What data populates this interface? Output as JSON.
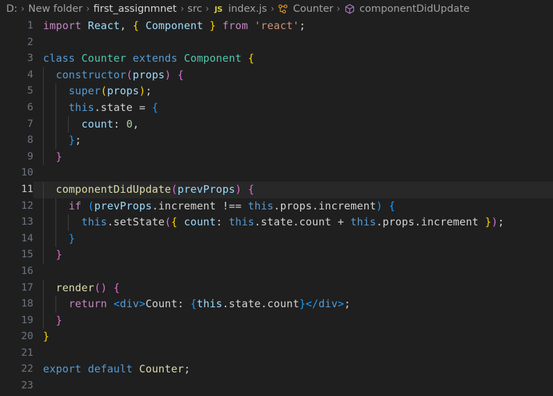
{
  "breadcrumb": {
    "items": [
      {
        "label": "D:",
        "icon": null,
        "bright": false
      },
      {
        "label": "New folder",
        "icon": null,
        "bright": false
      },
      {
        "label": "first_assignmnet",
        "icon": null,
        "bright": true
      },
      {
        "label": "src",
        "icon": null,
        "bright": false
      },
      {
        "label": "index.js",
        "icon": "js-file-icon",
        "bright": false
      },
      {
        "label": "Counter",
        "icon": "symbol-class-icon",
        "bright": false
      },
      {
        "label": "componentDidUpdate",
        "icon": "symbol-method-icon",
        "bright": false
      }
    ],
    "separator": "›"
  },
  "editor": {
    "language": "javascript",
    "current_line": 11,
    "total_lines": 23,
    "colors": {
      "background": "#1f1f1f",
      "current_line_background": "#282828",
      "line_number": "#6e7681",
      "line_number_active": "#cccccc",
      "foreground": "#d4d4d4",
      "keyword_control": "#c586c0",
      "keyword": "#569cd6",
      "variable": "#9cdcfe",
      "function": "#dcdcaa",
      "string": "#ce9178",
      "number": "#b5cea8",
      "bracket_yellow": "#ffd700",
      "bracket_pink": "#da70d6",
      "bracket_blue": "#179fff",
      "indent_guide": "#404040"
    },
    "lines": [
      {
        "n": 1,
        "text": "import React, { Component } from 'react';"
      },
      {
        "n": 2,
        "text": ""
      },
      {
        "n": 3,
        "text": "class Counter extends Component {"
      },
      {
        "n": 4,
        "text": "  constructor(props) {"
      },
      {
        "n": 5,
        "text": "    super(props);"
      },
      {
        "n": 6,
        "text": "    this.state = {"
      },
      {
        "n": 7,
        "text": "      count: 0,"
      },
      {
        "n": 8,
        "text": "    };"
      },
      {
        "n": 9,
        "text": "  }"
      },
      {
        "n": 10,
        "text": ""
      },
      {
        "n": 11,
        "text": "  componentDidUpdate(prevProps) {"
      },
      {
        "n": 12,
        "text": "    if (prevProps.increment !== this.props.increment) {"
      },
      {
        "n": 13,
        "text": "      this.setState({ count: this.state.count + this.props.increment });"
      },
      {
        "n": 14,
        "text": "    }"
      },
      {
        "n": 15,
        "text": "  }"
      },
      {
        "n": 16,
        "text": ""
      },
      {
        "n": 17,
        "text": "  render() {"
      },
      {
        "n": 18,
        "text": "    return <div>Count: {this.state.count}</div>;"
      },
      {
        "n": 19,
        "text": "  }"
      },
      {
        "n": 20,
        "text": "}"
      },
      {
        "n": 21,
        "text": ""
      },
      {
        "n": 22,
        "text": "export default Counter;"
      },
      {
        "n": 23,
        "text": ""
      }
    ],
    "tokens": [
      [
        [
          "import ",
          "kw"
        ],
        [
          "React",
          "ident"
        ],
        [
          ", ",
          "plain"
        ],
        [
          "{",
          "b-y"
        ],
        [
          " ",
          "plain"
        ],
        [
          "Component",
          "ident"
        ],
        [
          " ",
          "plain"
        ],
        [
          "}",
          "b-y"
        ],
        [
          " ",
          "plain"
        ],
        [
          "from",
          "kw"
        ],
        [
          " ",
          "plain"
        ],
        [
          "'react'",
          "str"
        ],
        [
          ";",
          "plain"
        ]
      ],
      [],
      [
        [
          "class",
          "kw2"
        ],
        [
          " ",
          "plain"
        ],
        [
          "Counter",
          "cls"
        ],
        [
          " ",
          "plain"
        ],
        [
          "extends",
          "kw2"
        ],
        [
          " ",
          "plain"
        ],
        [
          "Component",
          "cls"
        ],
        [
          " ",
          "plain"
        ],
        [
          "{",
          "b-y"
        ]
      ],
      [
        [
          "  ",
          "plain"
        ],
        [
          "constructor",
          "kw2"
        ],
        [
          "(",
          "b-p"
        ],
        [
          "props",
          "ident"
        ],
        [
          ")",
          "b-p"
        ],
        [
          " ",
          "plain"
        ],
        [
          "{",
          "b-p"
        ]
      ],
      [
        [
          "    ",
          "plain"
        ],
        [
          "super",
          "kw2"
        ],
        [
          "(",
          "b-y"
        ],
        [
          "props",
          "ident"
        ],
        [
          ")",
          "b-y"
        ],
        [
          ";",
          "plain"
        ]
      ],
      [
        [
          "    ",
          "plain"
        ],
        [
          "this",
          "kw2"
        ],
        [
          ".state",
          "plain"
        ],
        [
          " = ",
          "plain"
        ],
        [
          "{",
          "b-b"
        ]
      ],
      [
        [
          "      ",
          "plain"
        ],
        [
          "count",
          "ident"
        ],
        [
          ": ",
          "plain"
        ],
        [
          "0",
          "num"
        ],
        [
          ",",
          "plain"
        ]
      ],
      [
        [
          "    ",
          "plain"
        ],
        [
          "}",
          "b-b"
        ],
        [
          ";",
          "plain"
        ]
      ],
      [
        [
          "  ",
          "plain"
        ],
        [
          "}",
          "b-p"
        ]
      ],
      [],
      [
        [
          "  ",
          "plain"
        ],
        [
          "componentDidUpdate",
          "fn"
        ],
        [
          "(",
          "b-p"
        ],
        [
          "prevProps",
          "ident"
        ],
        [
          ")",
          "b-p"
        ],
        [
          " ",
          "plain"
        ],
        [
          "{",
          "b-p"
        ]
      ],
      [
        [
          "    ",
          "plain"
        ],
        [
          "if",
          "kw"
        ],
        [
          " ",
          "plain"
        ],
        [
          "(",
          "b-b"
        ],
        [
          "prevProps",
          "ident"
        ],
        [
          ".increment",
          "plain"
        ],
        [
          " !== ",
          "plain"
        ],
        [
          "this",
          "kw2"
        ],
        [
          ".props.increment",
          "plain"
        ],
        [
          ")",
          "b-b"
        ],
        [
          " ",
          "plain"
        ],
        [
          "{",
          "b-b"
        ]
      ],
      [
        [
          "      ",
          "plain"
        ],
        [
          "this",
          "kw2"
        ],
        [
          ".setState",
          "plain"
        ],
        [
          "(",
          "b-p"
        ],
        [
          "{",
          "b-y"
        ],
        [
          " ",
          "plain"
        ],
        [
          "count",
          "ident"
        ],
        [
          ": ",
          "plain"
        ],
        [
          "this",
          "kw2"
        ],
        [
          ".state.count",
          "plain"
        ],
        [
          " + ",
          "plain"
        ],
        [
          "this",
          "kw2"
        ],
        [
          ".props.increment",
          "plain"
        ],
        [
          " ",
          "plain"
        ],
        [
          "}",
          "b-y"
        ],
        [
          ")",
          "b-p"
        ],
        [
          ";",
          "plain"
        ]
      ],
      [
        [
          "    ",
          "plain"
        ],
        [
          "}",
          "b-b"
        ]
      ],
      [
        [
          "  ",
          "plain"
        ],
        [
          "}",
          "b-p"
        ]
      ],
      [],
      [
        [
          "  ",
          "plain"
        ],
        [
          "render",
          "fn"
        ],
        [
          "(",
          "b-p"
        ],
        [
          ")",
          "b-p"
        ],
        [
          " ",
          "plain"
        ],
        [
          "{",
          "b-p"
        ]
      ],
      [
        [
          "    ",
          "plain"
        ],
        [
          "return",
          "kw"
        ],
        [
          " ",
          "plain"
        ],
        [
          "<",
          "b-b"
        ],
        [
          "div",
          "tagname"
        ],
        [
          ">",
          "b-b"
        ],
        [
          "Count: ",
          "plain"
        ],
        [
          "{",
          "b-b"
        ],
        [
          "this",
          "ident"
        ],
        [
          ".state.count",
          "plain"
        ],
        [
          "}",
          "b-b"
        ],
        [
          "</",
          "b-b"
        ],
        [
          "div",
          "tagname"
        ],
        [
          ">",
          "b-b"
        ],
        [
          ";",
          "plain"
        ]
      ],
      [
        [
          "  ",
          "plain"
        ],
        [
          "}",
          "b-p"
        ]
      ],
      [
        [
          "}",
          "b-y"
        ]
      ],
      [],
      [
        [
          "export",
          "kw2"
        ],
        [
          " ",
          "plain"
        ],
        [
          "default",
          "kw2"
        ],
        [
          " ",
          "plain"
        ],
        [
          "Counter",
          "fn"
        ],
        [
          ";",
          "plain"
        ]
      ],
      []
    ],
    "indent_guides": [
      0,
      0,
      0,
      1,
      2,
      2,
      3,
      2,
      1,
      0,
      1,
      2,
      3,
      2,
      1,
      0,
      1,
      2,
      1,
      0,
      0,
      0,
      0
    ]
  }
}
